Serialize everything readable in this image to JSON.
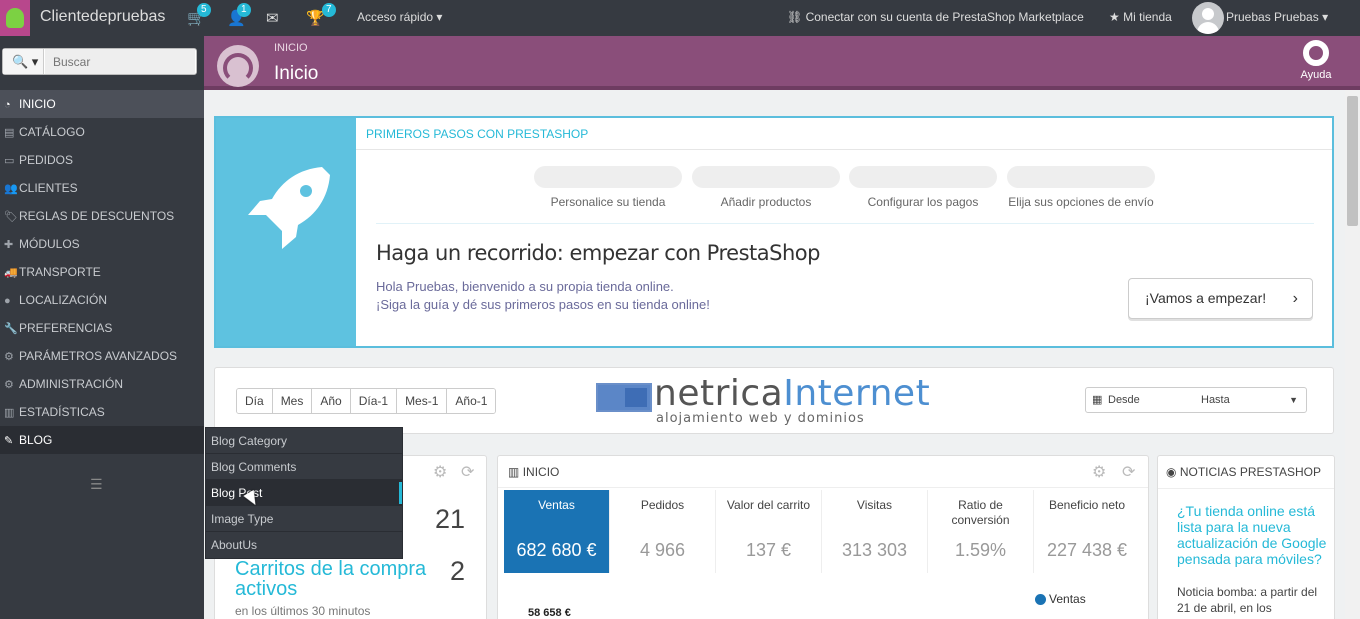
{
  "topbar": {
    "shop_name": "Clientedepruebas",
    "notifications": [
      {
        "icon": "shopping-cart-icon",
        "count": "5"
      },
      {
        "icon": "user-icon",
        "count": "1"
      },
      {
        "icon": "envelope-icon",
        "count": ""
      },
      {
        "icon": "trophy-icon",
        "count": "7"
      }
    ],
    "quick_access": "Acceso rápido",
    "connect_marketplace": "Conectar con su cuenta de PrestaShop Marketplace",
    "my_shop": "Mi tienda",
    "user_name": "Pruebas Pruebas"
  },
  "sidebar": {
    "search_placeholder": "Buscar",
    "items": [
      {
        "label": "INICIO",
        "icon": "dashboard-icon"
      },
      {
        "label": "CATÁLOGO",
        "icon": "book-icon"
      },
      {
        "label": "PEDIDOS",
        "icon": "credit-card-icon"
      },
      {
        "label": "CLIENTES",
        "icon": "users-icon"
      },
      {
        "label": "REGLAS DE DESCUENTOS",
        "icon": "tags-icon"
      },
      {
        "label": "MÓDULOS",
        "icon": "puzzle-icon"
      },
      {
        "label": "TRANSPORTE",
        "icon": "truck-icon"
      },
      {
        "label": "LOCALIZACIÓN",
        "icon": "globe-icon"
      },
      {
        "label": "PREFERENCIAS",
        "icon": "wrench-icon"
      },
      {
        "label": "PARÁMETROS AVANZADOS",
        "icon": "cogs-icon"
      },
      {
        "label": "ADMINISTRACIÓN",
        "icon": "cog-icon"
      },
      {
        "label": "ESTADÍSTICAS",
        "icon": "bar-chart-icon"
      },
      {
        "label": "BLOG",
        "icon": "pencil-square-icon"
      }
    ],
    "blog_submenu": [
      "Blog Category",
      "Blog Comments",
      "Blog Post",
      "Image Type",
      "AboutUs"
    ]
  },
  "page_header": {
    "breadcrumb": "INICIO",
    "title": "Inicio",
    "help_label": "Ayuda"
  },
  "onboarding": {
    "title": "PRIMEROS PASOS CON PRESTASHOP",
    "steps": [
      "Personalice su tienda",
      "Añadir productos",
      "Configurar los pagos",
      "Elija sus opciones de envío"
    ],
    "heading": "Haga un recorrido: empezar con PrestaShop",
    "line1": "Hola Pruebas, bienvenido a su propia tienda online.",
    "line2": "¡Siga la guía y dé sus primeros pasos en su tienda online!",
    "start_button": "¡Vamos a empezar!"
  },
  "calendar": {
    "periods": [
      "Día",
      "Mes",
      "Año",
      "Día-1",
      "Mes-1",
      "Año-1"
    ],
    "from_label": "Desde",
    "to_label": "Hasta"
  },
  "banner": {
    "brand_part1": "netrica",
    "brand_part2": "Internet",
    "tagline": "alojamiento web y dominios"
  },
  "activity": {
    "value1": "21",
    "label2": "Carritos de la compra activos",
    "value2": "2",
    "sub2": "en los últimos 30 minutos"
  },
  "dashboard": {
    "title": "INICIO",
    "kpis": [
      {
        "label": "Ventas",
        "value": "682 680 €"
      },
      {
        "label": "Pedidos",
        "value": "4 966"
      },
      {
        "label": "Valor del carrito",
        "value": "137 €"
      },
      {
        "label": "Visitas",
        "value": "313 303"
      },
      {
        "label": "Ratio de conversión",
        "value": "1.59%"
      },
      {
        "label": "Beneficio neto",
        "value": "227 438 €"
      }
    ],
    "legend": "Ventas",
    "y_max_label": "58 658 €"
  },
  "news": {
    "title": "NOTICIAS PRESTASHOP",
    "headline": "¿Tu tienda online está lista para la nueva actualización de Google pensada para móviles?",
    "body": "Noticia bomba: a partir del 21 de abril, en los"
  }
}
